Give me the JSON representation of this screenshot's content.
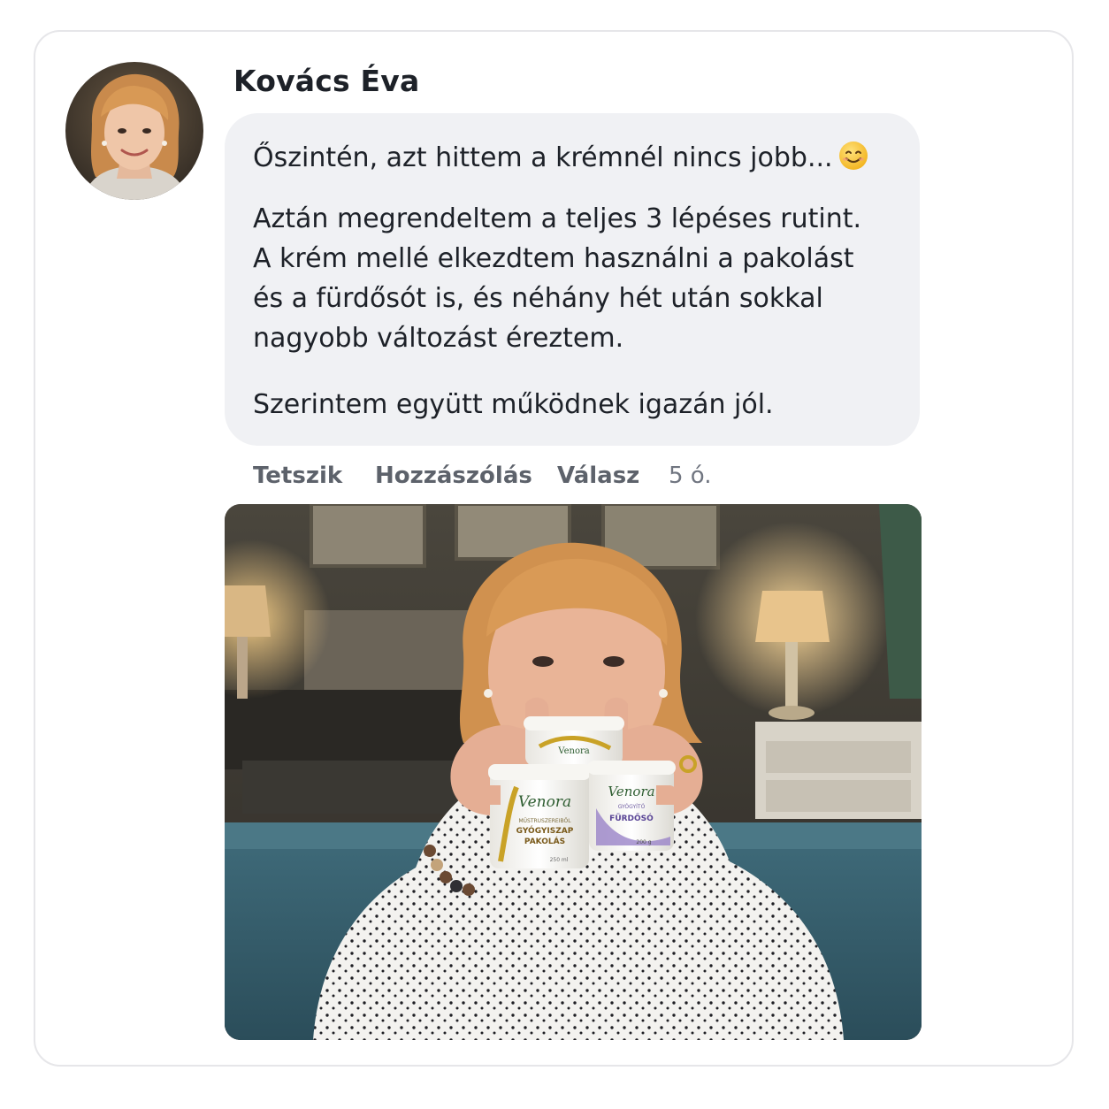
{
  "post": {
    "author_name": "Kovács Éva",
    "avatar_icon": "profile-photo-woman",
    "paragraphs": {
      "first": "Őszintén, azt hittem a krémnél nincs jobb...",
      "first_emoji": "smiling-face-icon",
      "second_lines": [
        "Aztán megrendeltem a teljes 3 lépéses rutint.",
        "A krém mellé elkezdtem használni a pakolást",
        "és a fürdősót is, és néhány hét után sokkal",
        "nagyobb változást éreztem."
      ],
      "third": "Szerintem együtt működnek igazán jól."
    }
  },
  "actions": {
    "like_label": "Tetszik",
    "comment_label": "Hozzászólás",
    "reply_label": "Válasz",
    "timestamp": "5 ó."
  },
  "photo": {
    "products": {
      "small_jar": {
        "brand": "Venora"
      },
      "left_jar": {
        "brand": "Venora",
        "subtitle": "MŰSTRUSZEREIBŐL",
        "name_line1": "GYÓGYISZAP",
        "name_line2": "PAKOLÁS",
        "volume": "250 ml"
      },
      "right_jar": {
        "brand": "Venora",
        "subtitle": "GYÓGYÍTÓ",
        "name": "FÜRDŐSÓ",
        "weight": "200 g"
      }
    }
  },
  "colors": {
    "bubble": "#f0f1f4",
    "text": "#1d2128",
    "action_text": "#5d626b",
    "card_border": "#e6e6e9"
  }
}
